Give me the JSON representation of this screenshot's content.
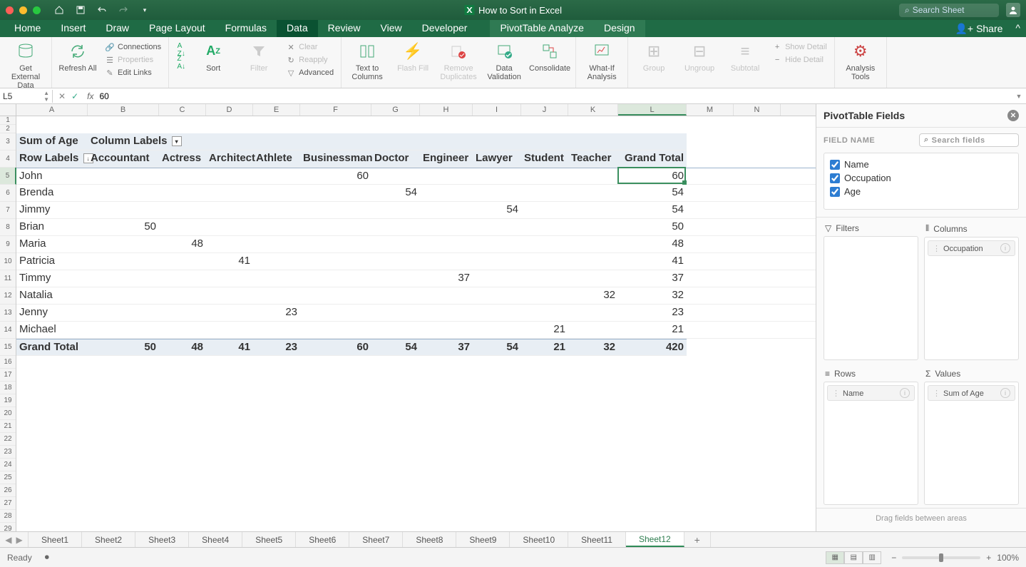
{
  "title": "How to Sort in Excel",
  "search_placeholder": "Search Sheet",
  "tabs": [
    "Home",
    "Insert",
    "Draw",
    "Page Layout",
    "Formulas",
    "Data",
    "Review",
    "View",
    "Developer"
  ],
  "active_tab": "Data",
  "context_tabs": [
    "PivotTable Analyze",
    "Design"
  ],
  "share_label": "Share",
  "ribbon": {
    "ext_data": "Get External Data",
    "refresh": "Refresh All",
    "connections": "Connections",
    "properties": "Properties",
    "edit_links": "Edit Links",
    "sort": "Sort",
    "filter": "Filter",
    "clear": "Clear",
    "reapply": "Reapply",
    "advanced": "Advanced",
    "text_cols": "Text to Columns",
    "flash_fill": "Flash Fill",
    "remove_dup": "Remove Duplicates",
    "data_val": "Data Validation",
    "consolidate": "Consolidate",
    "whatif": "What-If Analysis",
    "group": "Group",
    "ungroup": "Ungroup",
    "subtotal": "Subtotal",
    "show_detail": "Show Detail",
    "hide_detail": "Hide Detail",
    "analysis": "Analysis Tools"
  },
  "name_box": "L5",
  "formula_value": "60",
  "columns": {
    "letters": [
      "A",
      "B",
      "C",
      "D",
      "E",
      "F",
      "G",
      "H",
      "I",
      "J",
      "K",
      "L",
      "M",
      "N"
    ],
    "widths": [
      100,
      100,
      66,
      66,
      66,
      100,
      68,
      74,
      68,
      66,
      70,
      96,
      66,
      66
    ]
  },
  "selected_col": "L",
  "selected_row": 5,
  "pivot": {
    "measure": "Sum of Age",
    "col_label": "Column Labels",
    "row_label": "Row Labels",
    "col_headers": [
      "Accountant",
      "Actress",
      "Architect",
      "Athlete",
      "Businessman",
      "Doctor",
      "Engineer",
      "Lawyer",
      "Student",
      "Teacher",
      "Grand Total"
    ],
    "rows": [
      {
        "label": "John",
        "vals": [
          "",
          "",
          "",
          "",
          "60",
          "",
          "",
          "",
          "",
          "",
          "60"
        ]
      },
      {
        "label": "Brenda",
        "vals": [
          "",
          "",
          "",
          "",
          "",
          "54",
          "",
          "",
          "",
          "",
          "54"
        ]
      },
      {
        "label": "Jimmy",
        "vals": [
          "",
          "",
          "",
          "",
          "",
          "",
          "",
          "54",
          "",
          "",
          "54"
        ]
      },
      {
        "label": "Brian",
        "vals": [
          "50",
          "",
          "",
          "",
          "",
          "",
          "",
          "",
          "",
          "",
          "50"
        ]
      },
      {
        "label": "Maria",
        "vals": [
          "",
          "48",
          "",
          "",
          "",
          "",
          "",
          "",
          "",
          "",
          "48"
        ]
      },
      {
        "label": "Patricia",
        "vals": [
          "",
          "",
          "41",
          "",
          "",
          "",
          "",
          "",
          "",
          "",
          "41"
        ]
      },
      {
        "label": "Timmy",
        "vals": [
          "",
          "",
          "",
          "",
          "",
          "",
          "37",
          "",
          "",
          "",
          "37"
        ]
      },
      {
        "label": "Natalia",
        "vals": [
          "",
          "",
          "",
          "",
          "",
          "",
          "",
          "",
          "",
          "32",
          "32"
        ]
      },
      {
        "label": "Jenny",
        "vals": [
          "",
          "",
          "",
          "23",
          "",
          "",
          "",
          "",
          "",
          "",
          "23"
        ]
      },
      {
        "label": "Michael",
        "vals": [
          "",
          "",
          "",
          "",
          "",
          "",
          "",
          "",
          "21",
          "",
          "21"
        ]
      }
    ],
    "total_label": "Grand Total",
    "totals": [
      "50",
      "48",
      "41",
      "23",
      "60",
      "54",
      "37",
      "54",
      "21",
      "32",
      "420"
    ]
  },
  "pane": {
    "title": "PivotTable Fields",
    "field_name": "FIELD NAME",
    "search_ph": "Search fields",
    "fields": [
      {
        "name": "Name",
        "checked": true
      },
      {
        "name": "Occupation",
        "checked": true
      },
      {
        "name": "Age",
        "checked": true
      }
    ],
    "filters": "Filters",
    "columns": "Columns",
    "rows": "Rows",
    "values": "Values",
    "col_pill": "Occupation",
    "row_pill": "Name",
    "val_pill": "Sum of Age",
    "footer": "Drag fields between areas"
  },
  "sheets": [
    "Sheet1",
    "Sheet2",
    "Sheet3",
    "Sheet4",
    "Sheet5",
    "Sheet6",
    "Sheet7",
    "Sheet8",
    "Sheet9",
    "Sheet10",
    "Sheet11",
    "Sheet12"
  ],
  "active_sheet": "Sheet12",
  "status": "Ready",
  "zoom": "100%"
}
